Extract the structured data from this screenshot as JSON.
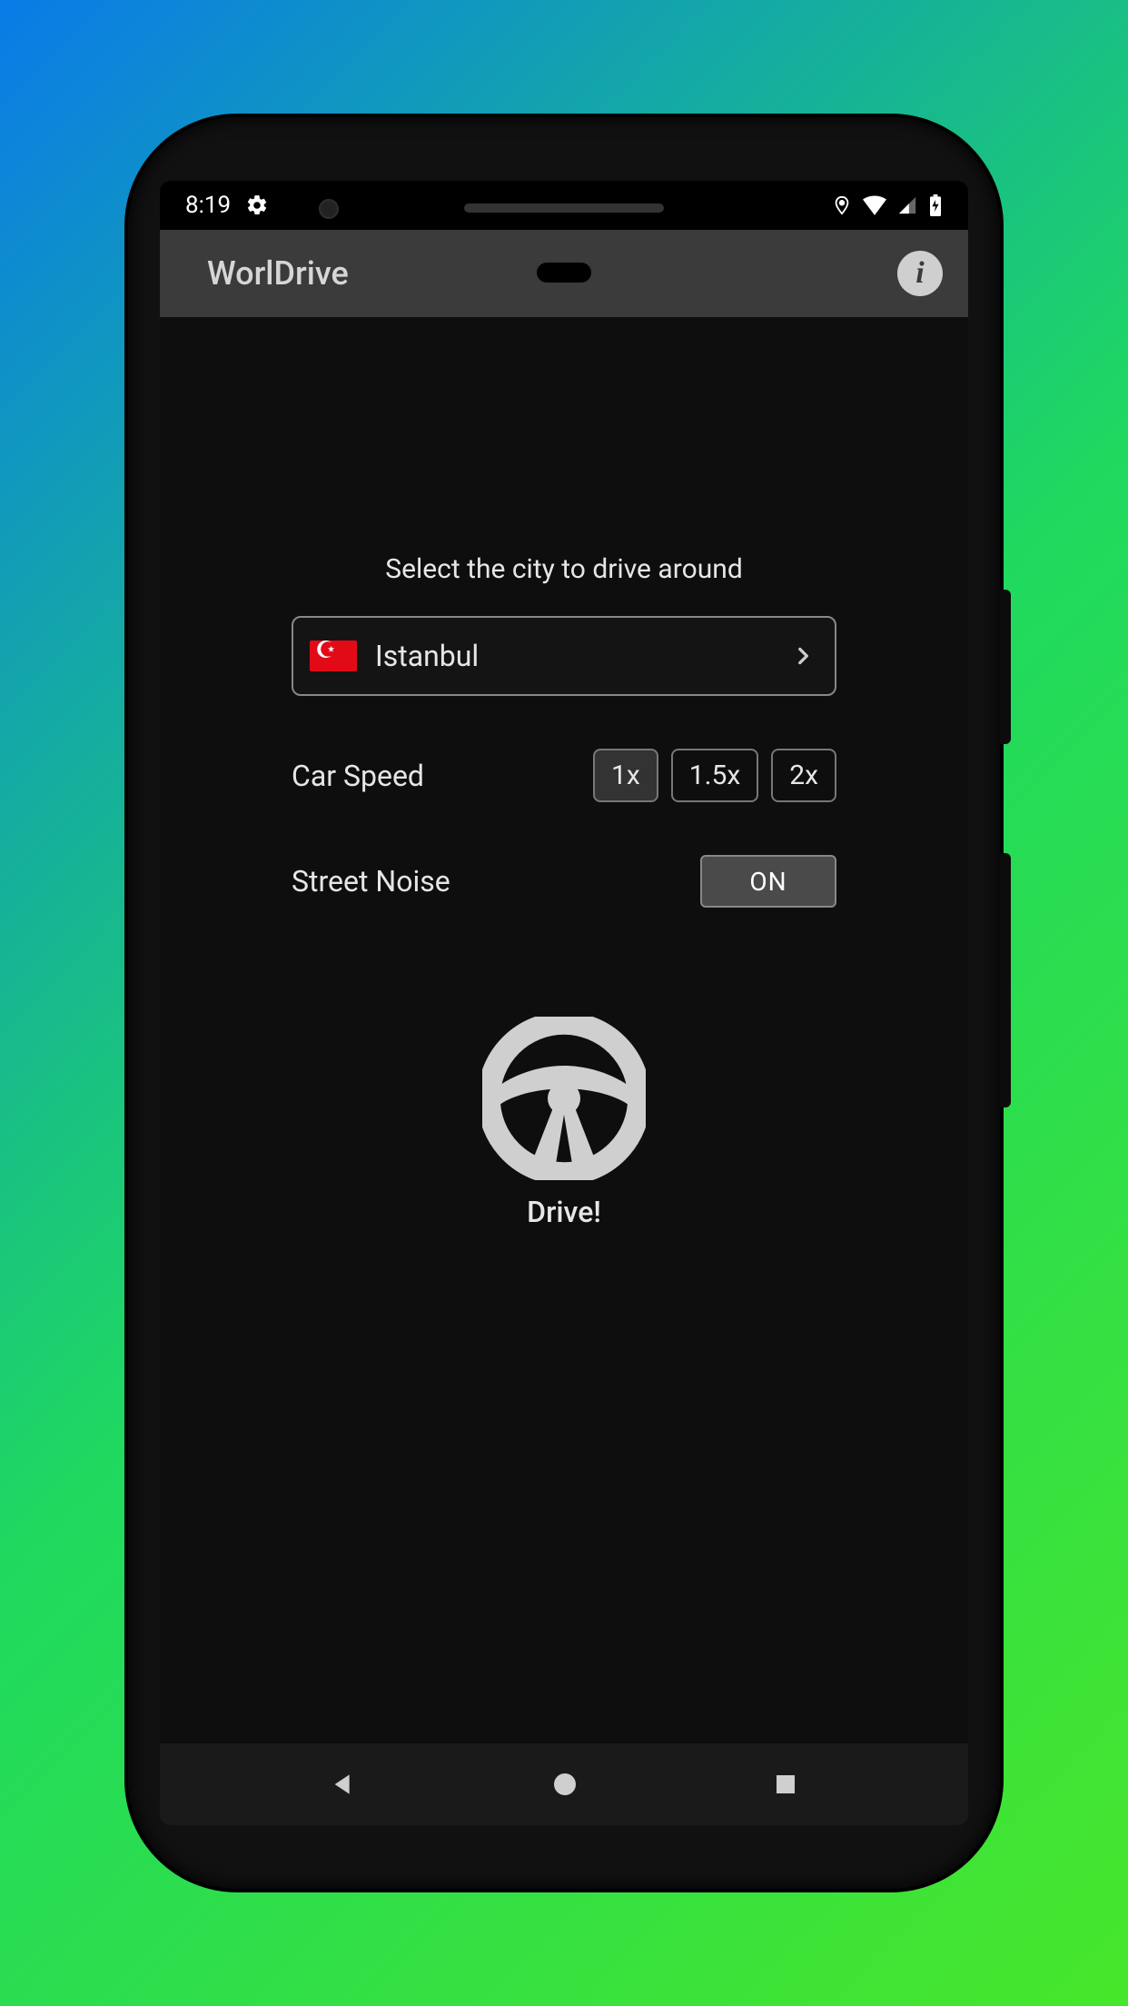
{
  "statusbar": {
    "time": "8:19"
  },
  "appbar": {
    "title": "WorlDrive",
    "info_label": "i"
  },
  "main": {
    "prompt": "Select the city to drive around",
    "city": "Istanbul",
    "speed_label": "Car Speed",
    "speed_options": [
      "1x",
      "1.5x",
      "2x"
    ],
    "speed_selected": "1x",
    "noise_label": "Street Noise",
    "noise_value": "ON",
    "drive_label": "Drive!"
  }
}
